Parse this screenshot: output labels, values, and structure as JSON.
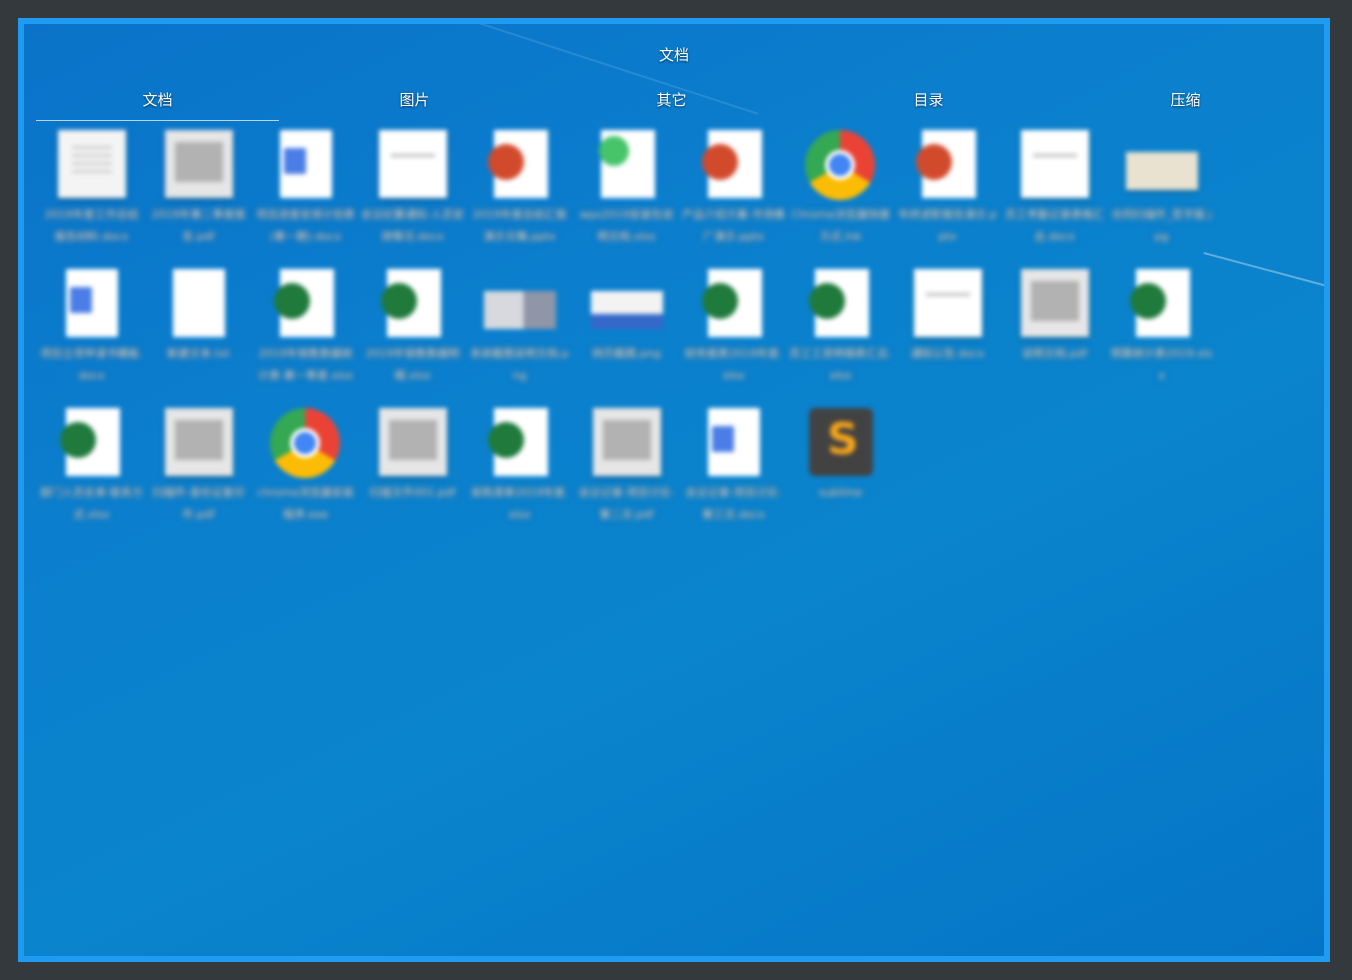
{
  "window": {
    "title": "文档"
  },
  "tabs": [
    {
      "label": "文档",
      "active": true
    },
    {
      "label": "图片",
      "active": false
    },
    {
      "label": "其它",
      "active": false
    },
    {
      "label": "目录",
      "active": false
    },
    {
      "label": "压缩",
      "active": false
    }
  ],
  "files": [
    {
      "name": "2019年度工作总结报告材料.docx",
      "icon": "document-thumbnail-icon"
    },
    {
      "name": "2019年第二季度报告.pdf",
      "icon": "scanned-document-icon"
    },
    {
      "name": "项目进度安排计划表(第一期).docx",
      "icon": "word-document-icon"
    },
    {
      "name": "会议纪要通知-人员安排情况.docx",
      "icon": "document-thumbnail-icon"
    },
    {
      "name": "2019年度总结汇报演示文稿.pptx",
      "icon": "powerpoint-icon"
    },
    {
      "name": "wps2019安装包说明文档.xlsx",
      "icon": "wps-file-icon"
    },
    {
      "name": "产品介绍方案-市场推广演示.pptx",
      "icon": "powerpoint-icon"
    },
    {
      "name": "Chrome浏览器快捷方式.lnk",
      "icon": "chrome-icon"
    },
    {
      "name": "年终述职报告演示.pptx",
      "icon": "powerpoint-icon"
    },
    {
      "name": "员工考勤记录表格汇总.docx",
      "icon": "document-thumbnail-icon"
    },
    {
      "name": "合同扫描件_签字版.jpg",
      "icon": "image-thumbnail-icon"
    },
    {
      "name": "项目立项申请书模板.docx",
      "icon": "word-document-icon"
    },
    {
      "name": "新建文本.txt",
      "icon": "blank-file-icon"
    },
    {
      "name": "2019年销售数据统计表-第一季度.xlsx",
      "icon": "excel-icon"
    },
    {
      "name": "2019年销售数据明细.xlsx",
      "icon": "excel-icon"
    },
    {
      "name": "系统截图说明文档.png",
      "icon": "screenshot-thumbnail-icon"
    },
    {
      "name": "网页截图.png",
      "icon": "screenshot-thumbnail-icon"
    },
    {
      "name": "财务报表2019年度.xlsx",
      "icon": "excel-icon"
    },
    {
      "name": "员工工资明细表汇总.xlsx",
      "icon": "excel-icon"
    },
    {
      "name": "通知公告.docx",
      "icon": "document-thumbnail-icon"
    },
    {
      "name": "说明文档.pdf",
      "icon": "scanned-document-icon"
    },
    {
      "name": "预算统计表2019.xlsx",
      "icon": "excel-icon"
    },
    {
      "name": "部门人员名单-联系方式.xlsx",
      "icon": "excel-icon"
    },
    {
      "name": "扫描件-身份证复印件.pdf",
      "icon": "scanned-document-icon"
    },
    {
      "name": "chrome浏览器安装程序.exe",
      "icon": "chrome-icon"
    },
    {
      "name": "扫描文件001.pdf",
      "icon": "scanned-document-icon"
    },
    {
      "name": "采购清单2019年度.xlsx",
      "icon": "excel-icon"
    },
    {
      "name": "会议记录-项目讨论-第二次.pdf",
      "icon": "scanned-document-icon"
    },
    {
      "name": "会议记录-项目讨论-第三次.docx",
      "icon": "word-document-icon"
    },
    {
      "name": "sublime",
      "icon": "sublime-text-icon"
    }
  ],
  "colors": {
    "background": "#33393d",
    "window_border": "#1f9bf2",
    "desktop_blue": "#0a7ecb"
  }
}
